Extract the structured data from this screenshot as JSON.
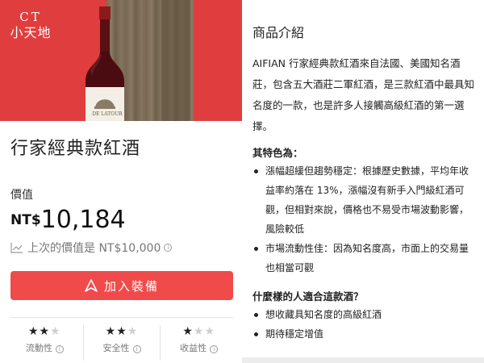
{
  "colors": {
    "brand_red": "#e03e3e",
    "cta_red": "#f04a4a"
  },
  "brand": {
    "line1": "CT",
    "line2": "小天地"
  },
  "product": {
    "bottle_label": "DE LATOUR",
    "title": "行家經典款紅酒",
    "value_label": "價值",
    "currency": "NT$",
    "price": "10,184",
    "previous_value": "上次的價值是 NT$10,000",
    "cta_label": "加入裝備",
    "ratings": [
      {
        "label": "流動性",
        "stars": 2,
        "max": 3
      },
      {
        "label": "安全性",
        "stars": 2,
        "max": 3
      },
      {
        "label": "收益性",
        "stars": 1,
        "max": 3
      }
    ]
  },
  "intro": {
    "title": "商品介紹",
    "description": "AIFIAN 行家經典款紅酒來自法國、美國知名酒莊，包含五大酒莊二軍紅酒，是三款紅酒中最具知名度的一款，也是許多人接觸高級紅酒的第一選擇。",
    "features_title": "其特色為：",
    "features": [
      "漲幅超緩但趨勢穩定：根據歷史數據，平均年收益率約落在 13%，漲幅沒有新手入門級紅酒可觀，但相對來說，價格也不易受市場波動影響，風險較低",
      "市場流動性佳：因為知名度高，市面上的交易量也相當可觀"
    ],
    "who_title": "什麼樣的人適合這款酒？",
    "who": [
      "想收藏具知名度的高級紅酒",
      "期待穩定增值"
    ]
  },
  "icons": [
    "chart-line-icon",
    "info-icon",
    "arrow-up-icon",
    "star-icon"
  ]
}
